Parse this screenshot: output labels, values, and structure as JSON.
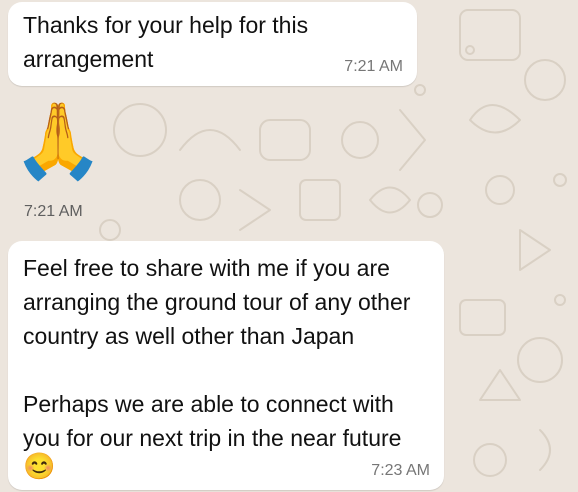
{
  "chat": {
    "messages": [
      {
        "text": "Thanks for your help for this\narrangement",
        "time": "7:21 AM"
      },
      {
        "emoji": "🙏",
        "time": "7:21 AM"
      },
      {
        "text": "Feel free to share with me if you are\narranging the ground tour of any other\ncountry as well other than Japan\n\nPerhaps we are able to connect with\nyou for our next trip in the near future",
        "emoji": "😊",
        "time": "7:23 AM"
      }
    ]
  },
  "theme": {
    "background": "#ece5dd",
    "bubble": "#ffffff",
    "timestamp": "#767676"
  }
}
